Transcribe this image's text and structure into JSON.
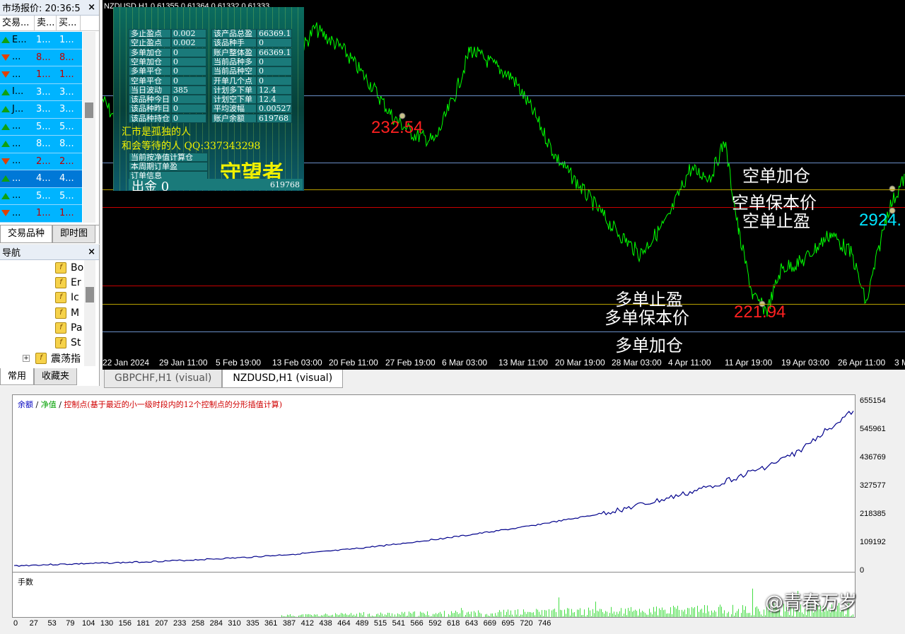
{
  "market_watch": {
    "title": "市场报价: 20:36:5",
    "columns": [
      "交易...",
      "卖...",
      "买..."
    ],
    "rows": [
      {
        "symbol": "E...",
        "bid": "1...",
        "ask": "1...",
        "dir": "up",
        "red": false,
        "sel": false
      },
      {
        "symbol": "...",
        "bid": "8...",
        "ask": "8...",
        "dir": "down",
        "red": true,
        "sel": false
      },
      {
        "symbol": "...",
        "bid": "1...",
        "ask": "1...",
        "dir": "down",
        "red": true,
        "sel": false
      },
      {
        "symbol": "I...",
        "bid": "3...",
        "ask": "3...",
        "dir": "up",
        "red": false,
        "sel": false
      },
      {
        "symbol": "J...",
        "bid": "3...",
        "ask": "3...",
        "dir": "up",
        "red": false,
        "sel": false
      },
      {
        "symbol": "...",
        "bid": "5...",
        "ask": "5...",
        "dir": "up",
        "red": false,
        "sel": false
      },
      {
        "symbol": "...",
        "bid": "8...",
        "ask": "8...",
        "dir": "up",
        "red": false,
        "sel": false
      },
      {
        "symbol": "...",
        "bid": "2...",
        "ask": "2...",
        "dir": "down",
        "red": true,
        "sel": false
      },
      {
        "symbol": "...",
        "bid": "4...",
        "ask": "4...",
        "dir": "up",
        "red": false,
        "sel": true
      },
      {
        "symbol": "...",
        "bid": "5...",
        "ask": "5...",
        "dir": "up",
        "red": false,
        "sel": false
      },
      {
        "symbol": "...",
        "bid": "1...",
        "ask": "1...",
        "dir": "down",
        "red": true,
        "sel": false
      }
    ],
    "tabs": [
      "交易品种",
      "即时图"
    ]
  },
  "navigator": {
    "title": "导航",
    "items": [
      "Bo",
      "Er",
      "Ic",
      "M",
      "Pa",
      "St"
    ],
    "root": "震荡指",
    "tabs": [
      "常用",
      "收藏夹"
    ]
  },
  "chart": {
    "title": "NZDUSD,H1  0.61355 0.61364 0.61332 0.61333",
    "info_rows": [
      [
        "多止盈点",
        "0.002",
        "该产品总盈",
        "66369.1"
      ],
      [
        "空止盈点",
        "0.002",
        "该品种手",
        "0"
      ],
      [
        "多单加仓",
        "0",
        "账户整体盈",
        "66369.1"
      ],
      [
        "空单加仓",
        "0",
        "当前品种多",
        "0"
      ],
      [
        "多单平仓",
        "0",
        "当前品种空",
        "0"
      ],
      [
        "空单平仓",
        "0",
        "开单几个点",
        "0"
      ],
      [
        "当日波动",
        "385",
        "计划多下单",
        "12.4"
      ],
      [
        "该品种今日",
        "0",
        "计划空下单",
        "12.4"
      ],
      [
        "该品种昨日",
        "0",
        "平均波幅",
        "0.00527"
      ],
      [
        "该品种持仓",
        "0",
        "账户余额",
        "619768"
      ]
    ],
    "info_text1": "汇市是孤独的人",
    "info_text2": "和会等待的人 QQ:337343298",
    "info_text3": "当前按净值计算仓",
    "info_text4": "本周期订单盈",
    "info_text5": "订单信息",
    "info_big": "守望者",
    "info_out": "出金 0",
    "info_out_value": "619768",
    "price_label_1": "232.54",
    "price_label_2": "221.94",
    "price_label_3": "2924.",
    "labels": {
      "short_add": "空单加仓",
      "short_breakeven": "空单保本价",
      "short_tp": "空单止盈",
      "long_tp": "多单止盈",
      "long_breakeven": "多单保本价",
      "long_add": "多单加仓"
    },
    "time_axis": [
      "22 Jan 2024",
      "29 Jan 11:00",
      "5 Feb 19:00",
      "13 Feb 03:00",
      "20 Feb 11:00",
      "27 Feb 19:00",
      "6 Mar 03:00",
      "13 Mar 11:00",
      "20 Mar 19:00",
      "28 Mar 03:00",
      "4 Apr 11:00",
      "11 Apr 19:00",
      "19 Apr 03:00",
      "26 Apr 11:00",
      "3 M"
    ],
    "tabs": [
      "GBPCHF,H1 (visual)",
      "NZDUSD,H1 (visual)"
    ]
  },
  "tester": {
    "legend_balance": "余额",
    "legend_equity": "净值",
    "legend_control": "控制点(基于最近的小一级时段内的12个控制点的分形插值计算)",
    "lots_label": "手数",
    "y_ticks": [
      "655154",
      "545961",
      "436769",
      "327577",
      "218385",
      "109192",
      "0"
    ],
    "x_ticks": [
      "0",
      "27",
      "53",
      "79",
      "104",
      "130",
      "156",
      "181",
      "207",
      "233",
      "258",
      "284",
      "310",
      "335",
      "361",
      "387",
      "412",
      "438",
      "464",
      "489",
      "515",
      "541",
      "566",
      "592",
      "618",
      "643",
      "669",
      "695",
      "720",
      "746"
    ],
    "watermark": "@青春万岁"
  },
  "chart_data": {
    "type": "line",
    "title": "",
    "xlabel": "",
    "ylabel": "",
    "x": [
      0,
      27,
      53,
      79,
      104,
      130,
      156,
      181,
      207,
      233,
      258,
      284,
      310,
      335,
      361,
      387,
      412,
      438,
      464,
      489,
      515,
      541,
      566,
      592,
      618,
      643,
      669,
      695,
      720,
      746,
      770
    ],
    "series": [
      {
        "name": "余额",
        "values": [
          12000,
          16000,
          19000,
          22000,
          25000,
          29000,
          33000,
          38000,
          43000,
          50000,
          57000,
          66000,
          76000,
          88000,
          100000,
          114000,
          127000,
          143000,
          158000,
          176000,
          194000,
          214000,
          236000,
          262000,
          290000,
          322000,
          360000,
          400000,
          450000,
          535000,
          605000
        ]
      }
    ],
    "ylim": [
      0,
      655154
    ],
    "xlim": [
      0,
      770
    ],
    "grid": false
  },
  "colors": {
    "price_line": "#00ff00",
    "balance_line": "#00008b"
  }
}
